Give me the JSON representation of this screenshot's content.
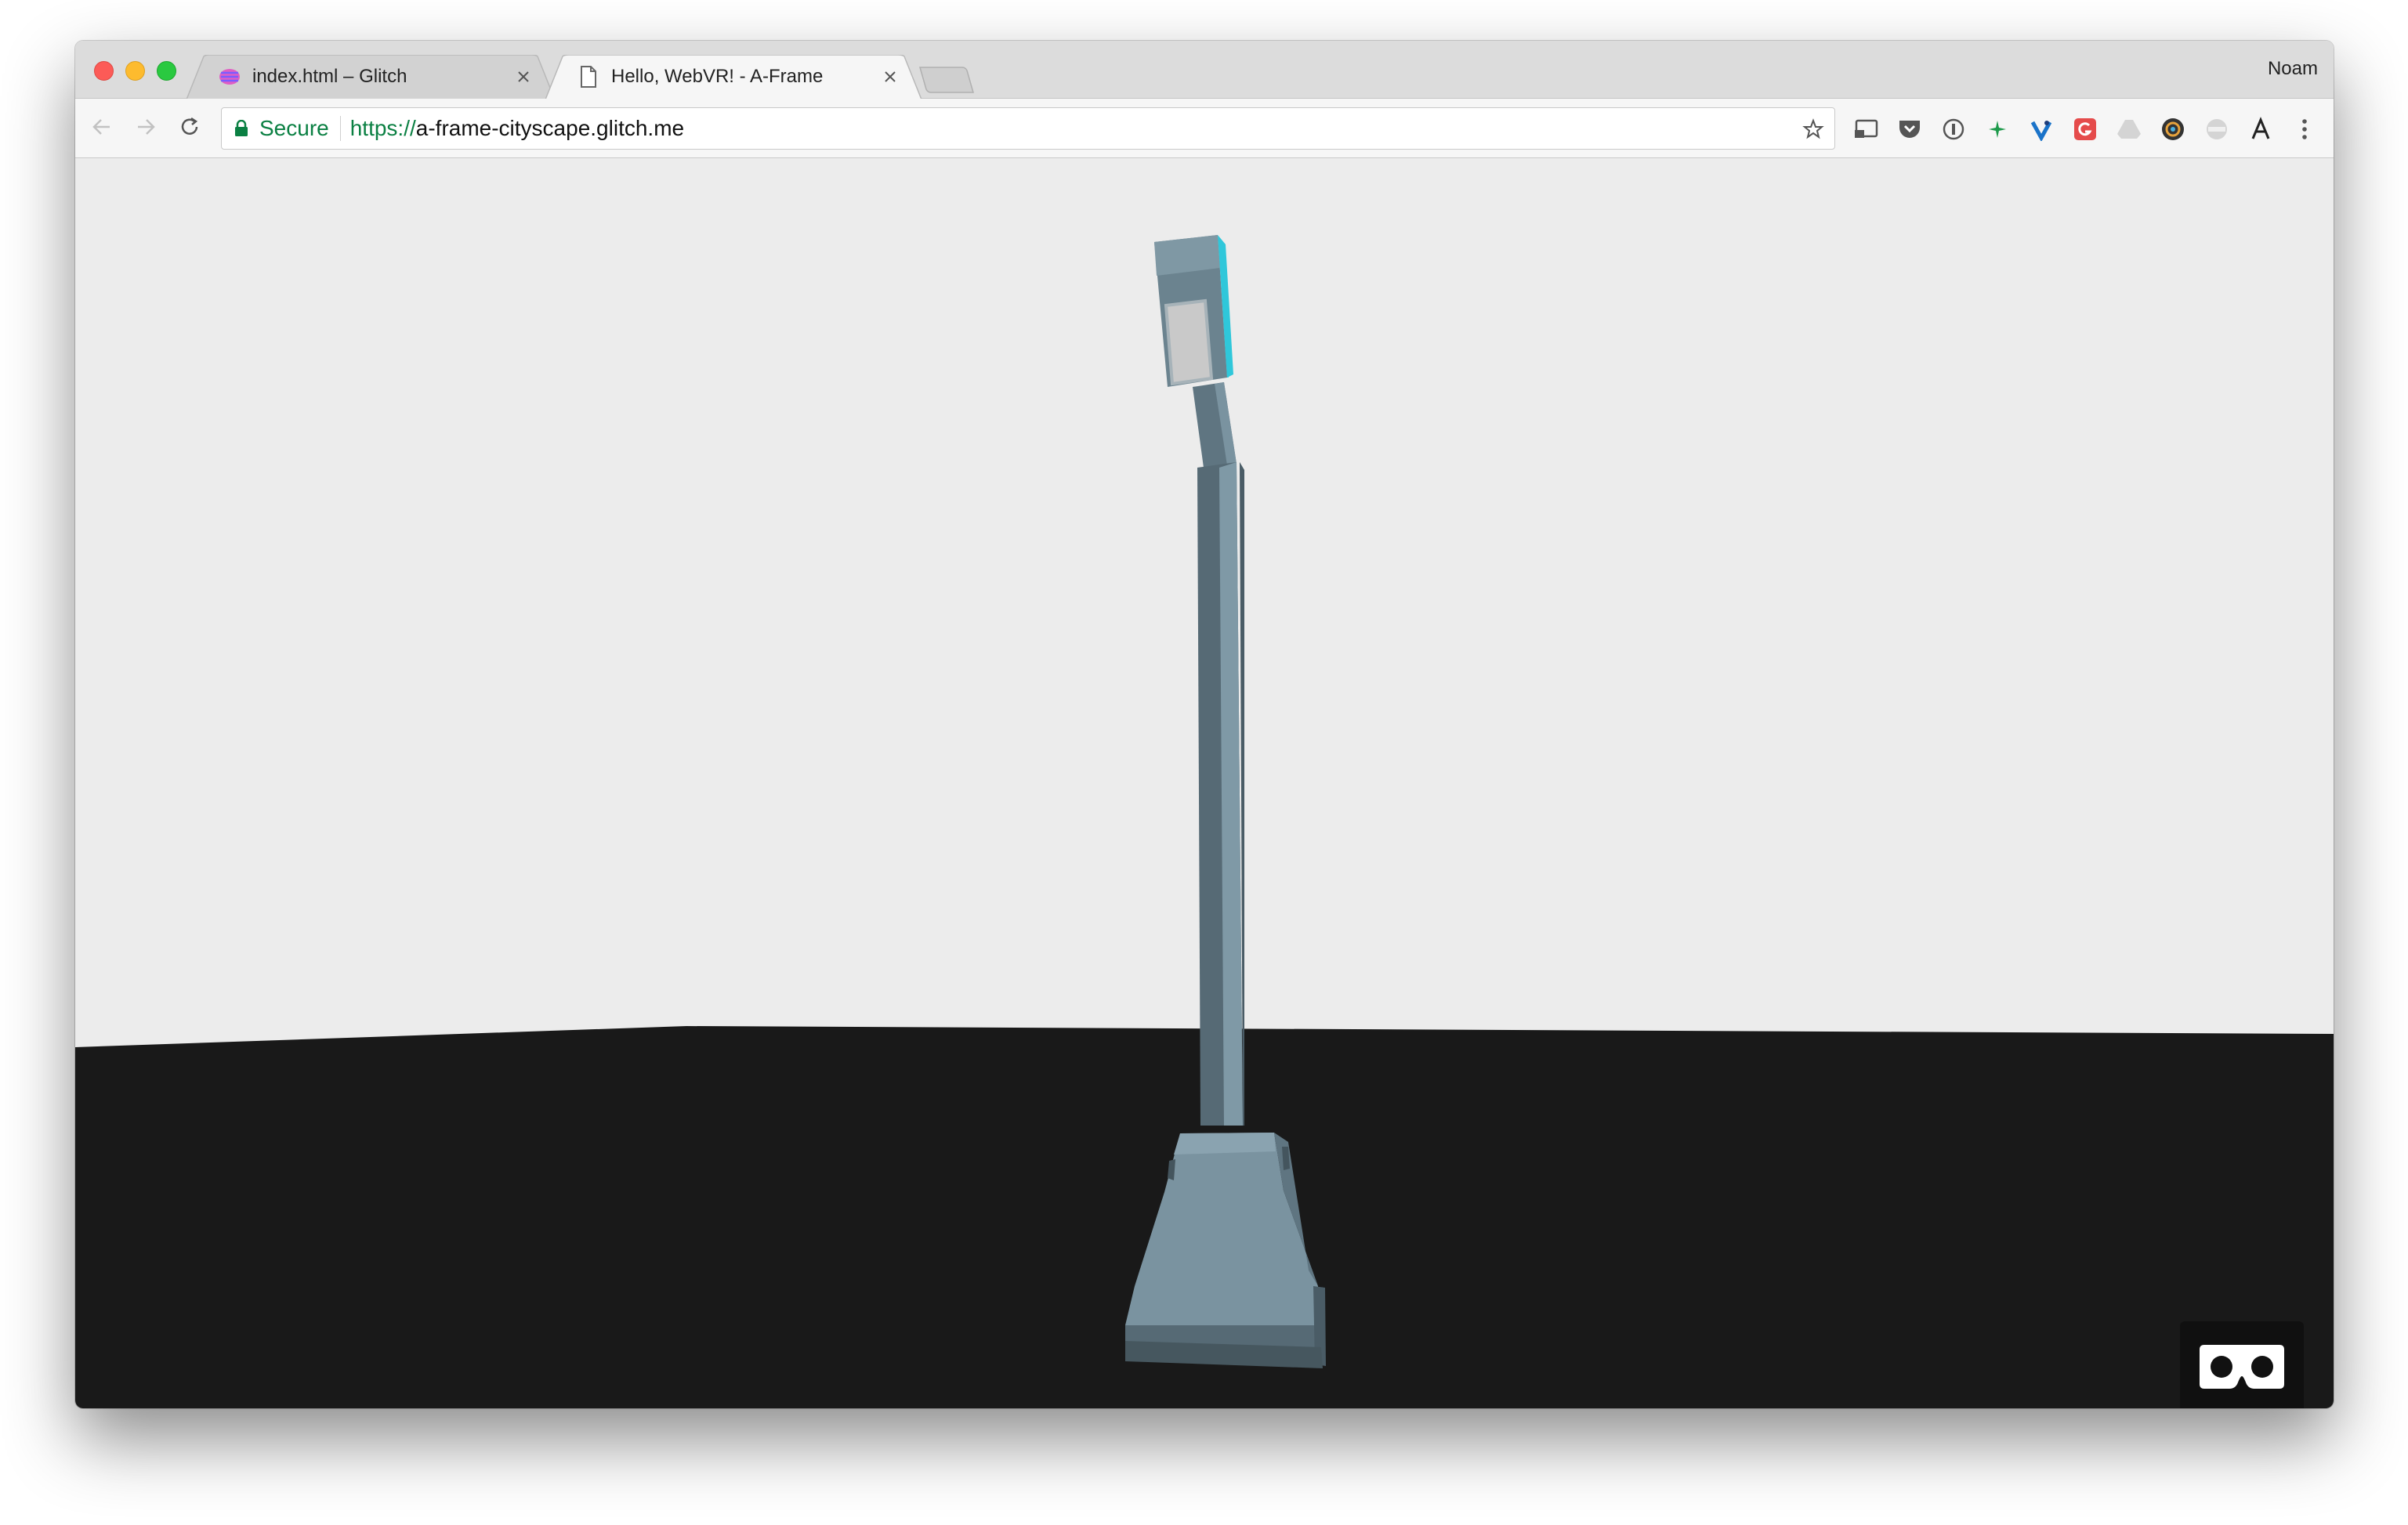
{
  "window": {
    "profile_name": "Noam"
  },
  "tabs": [
    {
      "title": "index.html – Glitch",
      "favicon": "glitch-fish-icon",
      "active": false
    },
    {
      "title": "Hello, WebVR! - A-Frame",
      "favicon": "document-icon",
      "active": true
    }
  ],
  "toolbar": {
    "security_label": "Secure",
    "url_scheme": "https://",
    "url_rest": "a-frame-cityscape.glitch.me",
    "extensions": [
      "cast-icon",
      "pocket-icon",
      "onepassword-icon",
      "sparkle-icon",
      "vimeo-icon",
      "grammarly-icon",
      "drive-icon",
      "color-picker-icon",
      "web-icon",
      "font-icon",
      "menu-icon"
    ]
  },
  "scene": {
    "sky_color": "#ececec",
    "ground_color": "#191919",
    "object": "street-lamp",
    "lamp_body_color": "#7a93a0",
    "lamp_shadow_color": "#566a75",
    "light_color": "#2fd6e8"
  },
  "vr_button": {
    "icon": "vr-headset-icon"
  }
}
